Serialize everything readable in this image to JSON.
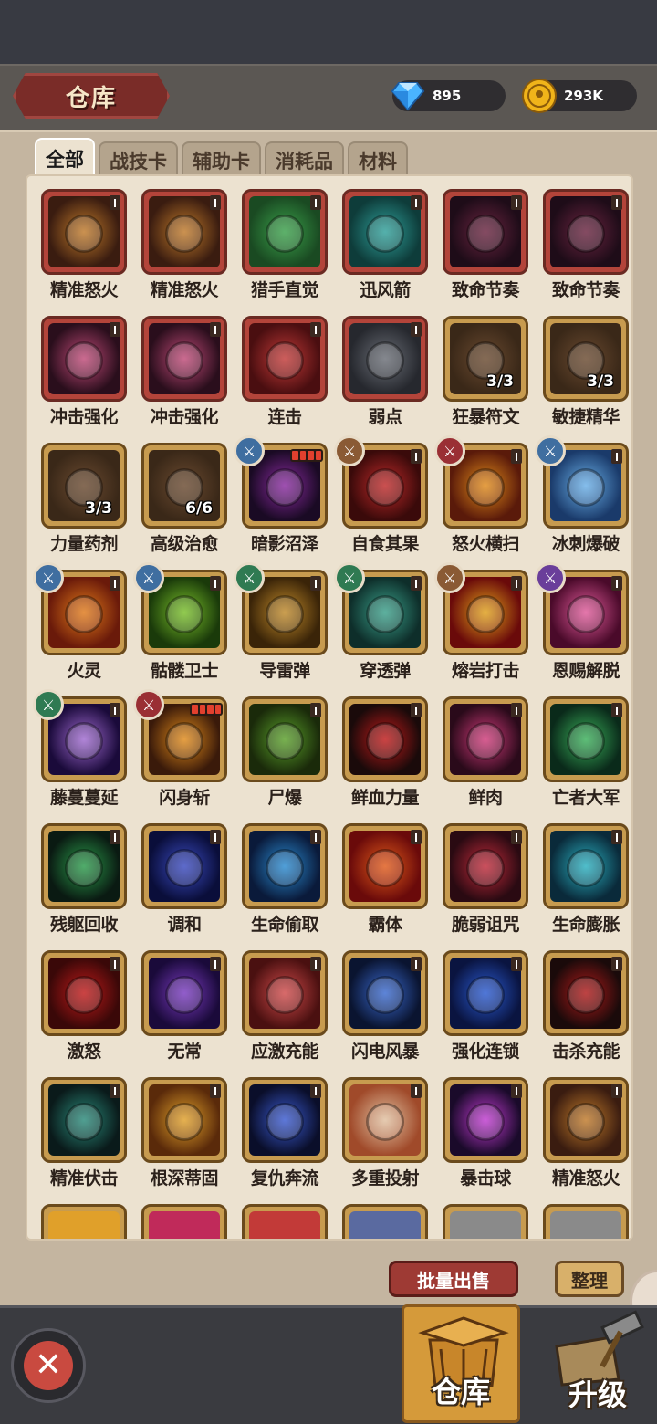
{
  "header": {
    "title": "仓库",
    "gems": "895",
    "gold": "293K"
  },
  "tabs": [
    {
      "label": "全部",
      "active": true
    },
    {
      "label": "战技卡",
      "active": false
    },
    {
      "label": "辅助卡",
      "active": false
    },
    {
      "label": "消耗品",
      "active": false
    },
    {
      "label": "材料",
      "active": false
    }
  ],
  "items": [
    {
      "name": "精准怒火",
      "frame": "red",
      "lvl": true,
      "icon": "fist-icon",
      "c1": "#c07a2a",
      "c2": "#3a1c10"
    },
    {
      "name": "精准怒火",
      "frame": "red",
      "lvl": true,
      "icon": "fist-icon",
      "c1": "#c07a2a",
      "c2": "#3a1c10"
    },
    {
      "name": "猎手直觉",
      "frame": "red",
      "lvl": true,
      "icon": "leaf-icon",
      "c1": "#3aa04a",
      "c2": "#1a4a22"
    },
    {
      "name": "迅风箭",
      "frame": "red",
      "lvl": true,
      "icon": "arrow-icon",
      "c1": "#2fa09a",
      "c2": "#0e3c3a"
    },
    {
      "name": "致命节奏",
      "frame": "red",
      "lvl": true,
      "icon": "strike-icon",
      "c1": "#6a2440",
      "c2": "#1e0c18"
    },
    {
      "name": "致命节奏",
      "frame": "red",
      "lvl": true,
      "icon": "strike-icon",
      "c1": "#6a2440",
      "c2": "#1e0c18"
    },
    {
      "name": "冲击强化",
      "frame": "red",
      "lvl": true,
      "icon": "impact-icon",
      "c1": "#c04a78",
      "c2": "#2a0e1c"
    },
    {
      "name": "冲击强化",
      "frame": "red",
      "lvl": true,
      "icon": "impact-icon",
      "c1": "#c04a78",
      "c2": "#2a0e1c"
    },
    {
      "name": "连击",
      "frame": "red",
      "lvl": true,
      "icon": "combo-icon",
      "c1": "#c23a38",
      "c2": "#4a0e10"
    },
    {
      "name": "弱点",
      "frame": "red",
      "lvl": true,
      "icon": "shield-icon",
      "c1": "#6a6e76",
      "c2": "#26282e"
    },
    {
      "name": "狂暴符文",
      "frame": "gold",
      "qty": "3/3",
      "icon": "red-potion-icon",
      "c1": "#6a4a30",
      "c2": "#3a2818"
    },
    {
      "name": "敏捷精华",
      "frame": "gold",
      "qty": "3/3",
      "icon": "blue-potion-icon",
      "c1": "#6a4a30",
      "c2": "#3a2818"
    },
    {
      "name": "力量药剂",
      "frame": "gold",
      "qty": "3/3",
      "icon": "yellow-potion-icon",
      "c1": "#6a4a30",
      "c2": "#3a2818"
    },
    {
      "name": "高级治愈",
      "frame": "gold",
      "qty": "6/6",
      "icon": "bread-icon",
      "c1": "#6a4a30",
      "c2": "#3a2818"
    },
    {
      "name": "暗影沼泽",
      "frame": "gold",
      "pips": true,
      "badge": "blue",
      "icon": "swamp-icon",
      "c1": "#8a2aa0",
      "c2": "#1a0a24"
    },
    {
      "name": "自食其果",
      "frame": "gold",
      "lvl": true,
      "badge": "brown",
      "icon": "thorn-shield-icon",
      "c1": "#c02a2a",
      "c2": "#3a0a0a"
    },
    {
      "name": "怒火横扫",
      "frame": "gold",
      "lvl": true,
      "badge": "red",
      "icon": "flame-icon",
      "c1": "#e08a1a",
      "c2": "#5a1a0a"
    },
    {
      "name": "冰刺爆破",
      "frame": "gold",
      "lvl": true,
      "badge": "blue",
      "icon": "ice-icon",
      "c1": "#6ab0e8",
      "c2": "#1a3a6a"
    },
    {
      "name": "火灵",
      "frame": "gold",
      "lvl": true,
      "badge": "blue",
      "icon": "fire-eye-icon",
      "c1": "#e07a1a",
      "c2": "#6a1a0a"
    },
    {
      "name": "骷髅卫士",
      "frame": "gold",
      "lvl": true,
      "badge": "blue",
      "icon": "skull-icon",
      "c1": "#7ac02a",
      "c2": "#1a3a0a"
    },
    {
      "name": "导雷弹",
      "frame": "gold",
      "lvl": true,
      "badge": "green",
      "icon": "bolt-spear-icon",
      "c1": "#c08a2a",
      "c2": "#3a2408"
    },
    {
      "name": "穿透弹",
      "frame": "gold",
      "lvl": true,
      "badge": "green",
      "icon": "pierce-icon",
      "c1": "#3aa08a",
      "c2": "#0e2e2a"
    },
    {
      "name": "熔岩打击",
      "frame": "gold",
      "lvl": true,
      "badge": "brown",
      "icon": "lava-icon",
      "c1": "#e0a01a",
      "c2": "#6a0a0a"
    },
    {
      "name": "恩赐解脱",
      "frame": "gold",
      "lvl": true,
      "badge": "purple",
      "icon": "pink-skull-icon",
      "c1": "#e05a9a",
      "c2": "#4a0a2a"
    },
    {
      "name": "藤蔓蔓延",
      "frame": "gold",
      "lvl": true,
      "badge": "green",
      "icon": "vortex-icon",
      "c1": "#a06ad0",
      "c2": "#1a0a3a"
    },
    {
      "name": "闪身斩",
      "frame": "gold",
      "pips": true,
      "badge": "red",
      "icon": "axe-icon",
      "c1": "#e08a1a",
      "c2": "#3a1a0a"
    },
    {
      "name": "尸爆",
      "frame": "gold",
      "lvl": true,
      "icon": "goo-icon",
      "c1": "#5aa02a",
      "c2": "#1a2a0a"
    },
    {
      "name": "鲜血力量",
      "frame": "gold",
      "lvl": true,
      "icon": "blood-icon",
      "c1": "#c01a1a",
      "c2": "#1a0a0a"
    },
    {
      "name": "鲜肉",
      "frame": "gold",
      "lvl": true,
      "icon": "figure-icon",
      "c1": "#d03a7a",
      "c2": "#2a0a1a"
    },
    {
      "name": "亡者大军",
      "frame": "gold",
      "lvl": true,
      "icon": "zombie-icon",
      "c1": "#3ab05a",
      "c2": "#0a2a1a"
    },
    {
      "name": "残躯回收",
      "frame": "gold",
      "lvl": true,
      "icon": "dark-skull-icon",
      "c1": "#2a9a4a",
      "c2": "#0a1a12"
    },
    {
      "name": "调和",
      "frame": "gold",
      "lvl": true,
      "icon": "harmony-icon",
      "c1": "#3a4ac0",
      "c2": "#0a0e3a"
    },
    {
      "name": "生命偷取",
      "frame": "gold",
      "lvl": true,
      "icon": "lifesteal-icon",
      "c1": "#2a8ad0",
      "c2": "#0a1a3a"
    },
    {
      "name": "霸体",
      "frame": "gold",
      "lvl": true,
      "icon": "fist-fire-icon",
      "c1": "#e05a1a",
      "c2": "#6a0a0a"
    },
    {
      "name": "脆弱诅咒",
      "frame": "gold",
      "lvl": true,
      "icon": "thumb-down-icon",
      "c1": "#c02a3a",
      "c2": "#2a0a12"
    },
    {
      "name": "生命膨胀",
      "frame": "gold",
      "lvl": true,
      "icon": "heal-swirl-icon",
      "c1": "#2ab0c0",
      "c2": "#0a2a3a"
    },
    {
      "name": "激怒",
      "frame": "gold",
      "lvl": true,
      "icon": "rage-icon",
      "c1": "#c01a1a",
      "c2": "#3a0808"
    },
    {
      "name": "无常",
      "frame": "gold",
      "lvl": true,
      "icon": "eye-icon",
      "c1": "#7a3ac0",
      "c2": "#1a0a3a"
    },
    {
      "name": "应激充能",
      "frame": "gold",
      "lvl": true,
      "icon": "gear-icon",
      "c1": "#d04a4a",
      "c2": "#4a1010"
    },
    {
      "name": "闪电风暴",
      "frame": "gold",
      "lvl": true,
      "icon": "storm-icon",
      "c1": "#3a6ad0",
      "c2": "#0a1430"
    },
    {
      "name": "强化连锁",
      "frame": "gold",
      "lvl": true,
      "icon": "chain-arrow-icon",
      "c1": "#2a5ad0",
      "c2": "#0a1440"
    },
    {
      "name": "击杀充能",
      "frame": "gold",
      "lvl": true,
      "icon": "armor-icon",
      "c1": "#b01a1a",
      "c2": "#1a0a0a"
    },
    {
      "name": "精准伏击",
      "frame": "gold",
      "lvl": true,
      "icon": "shadow-icon",
      "c1": "#2a8a7a",
      "c2": "#0a1a1a"
    },
    {
      "name": "根深蒂固",
      "frame": "gold",
      "lvl": true,
      "icon": "roots-icon",
      "c1": "#e0a02a",
      "c2": "#5a2a0a"
    },
    {
      "name": "复仇奔流",
      "frame": "gold",
      "lvl": true,
      "icon": "wave-icon",
      "c1": "#3a5ad0",
      "c2": "#0a0e2a"
    },
    {
      "name": "多重投射",
      "frame": "gold",
      "lvl": true,
      "icon": "multi-icon",
      "c1": "#e0c0a0",
      "c2": "#a04a2a"
    },
    {
      "name": "暴击球",
      "frame": "gold",
      "lvl": true,
      "icon": "orb-icon",
      "c1": "#c03ad0",
      "c2": "#1a0a2a"
    },
    {
      "name": "精准怒火",
      "frame": "gold",
      "lvl": true,
      "icon": "fist-icon",
      "c1": "#c07a2a",
      "c2": "#3a1c10"
    }
  ],
  "partial_row": [
    "#e0a02a",
    "#c02a5a",
    "#c23a38",
    "#5a6aa0",
    "#8a8a8a",
    "#8a8a8a"
  ],
  "actions": {
    "sell_label": "批量出售",
    "sort_label": "整理"
  },
  "bottom_nav": {
    "warehouse_label": "仓库",
    "upgrade_label": "升级"
  }
}
